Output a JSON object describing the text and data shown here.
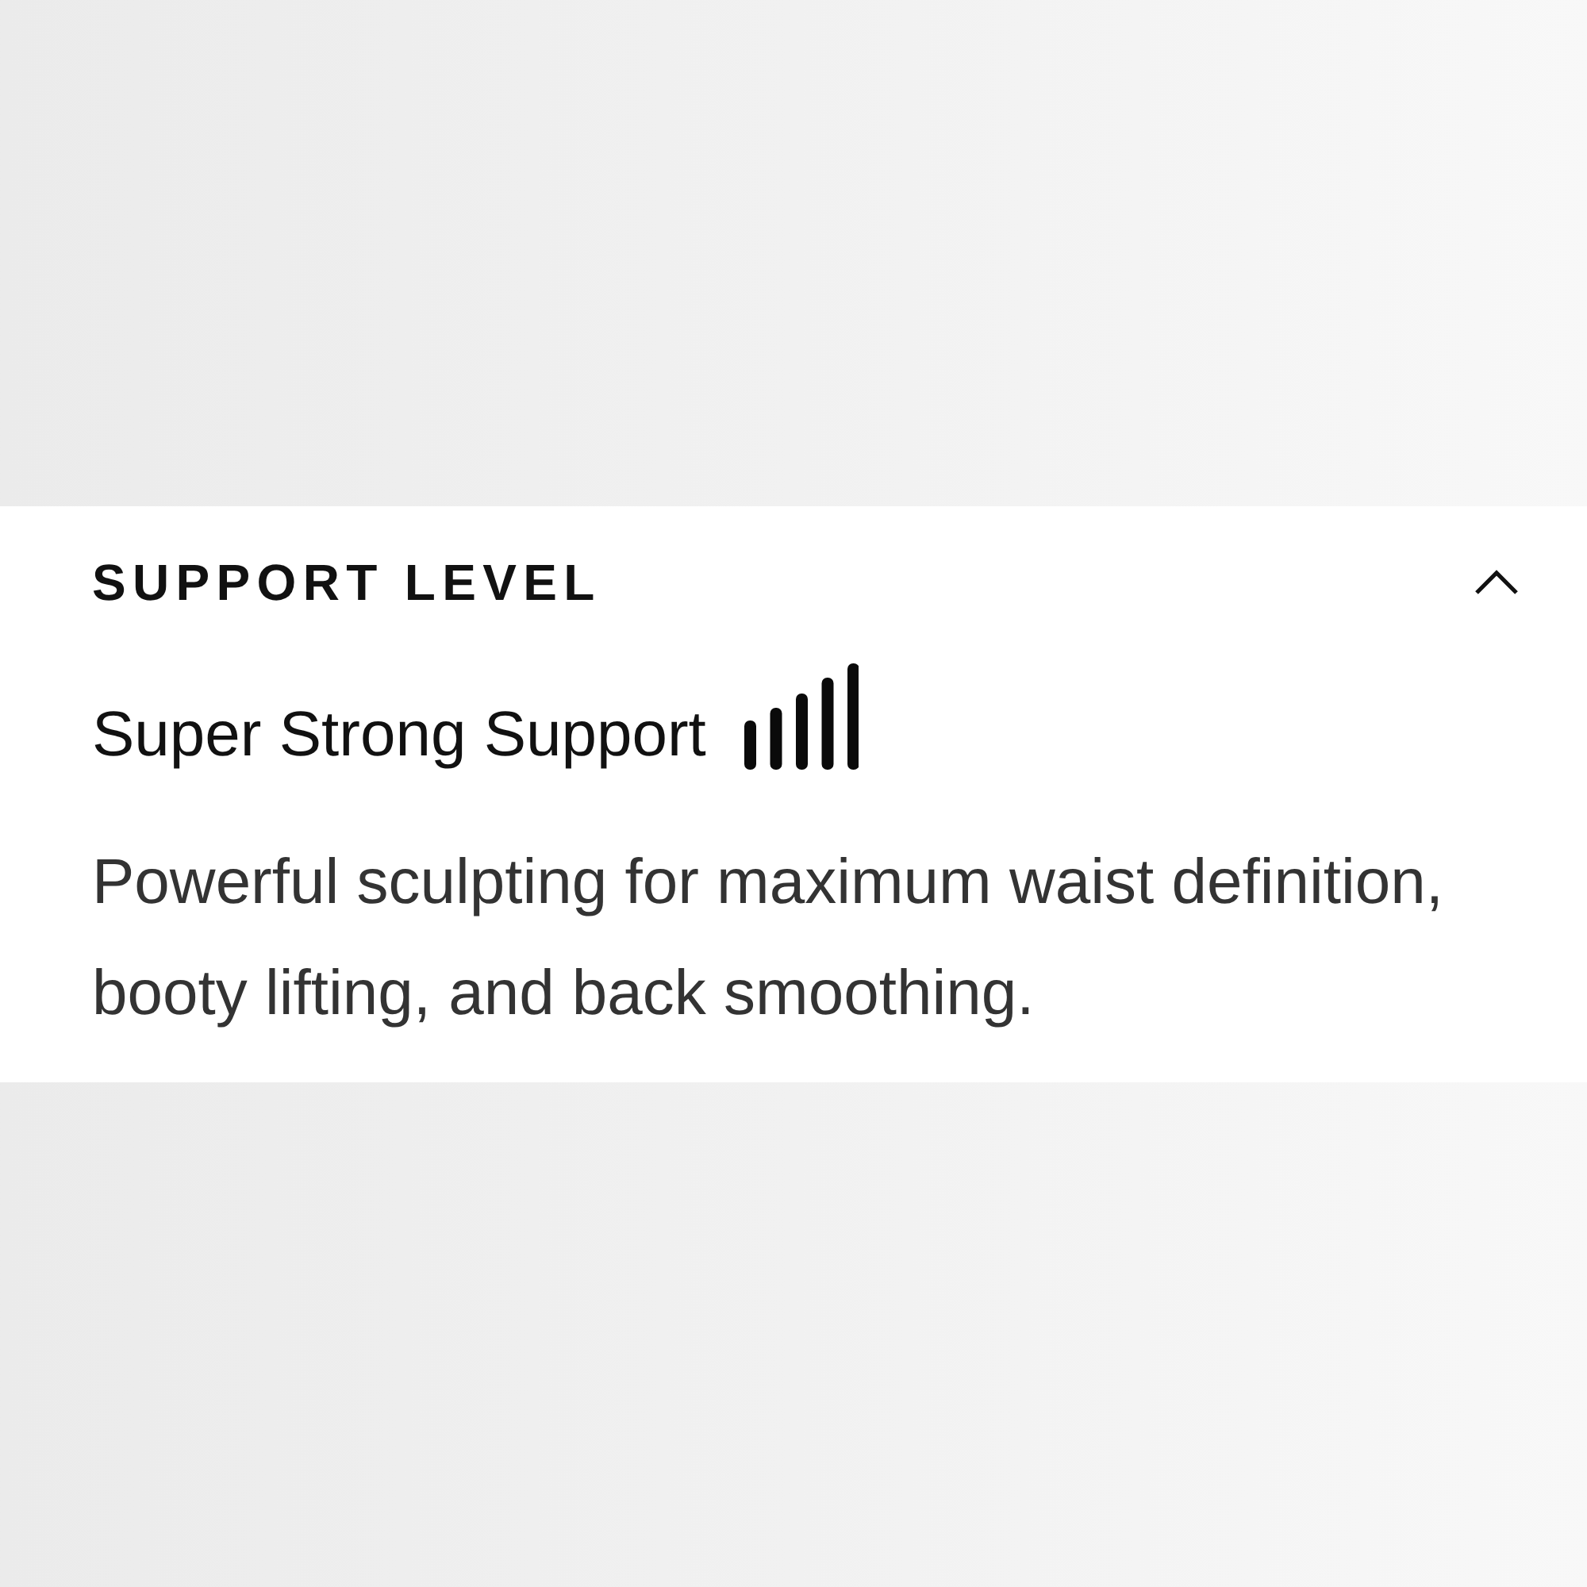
{
  "accordion": {
    "title": "SUPPORT LEVEL",
    "expanded": true,
    "subtitle": "Super Strong Support",
    "description": "Powerful sculpting for maximum waist definition, booty lifting, and back smoothing."
  }
}
